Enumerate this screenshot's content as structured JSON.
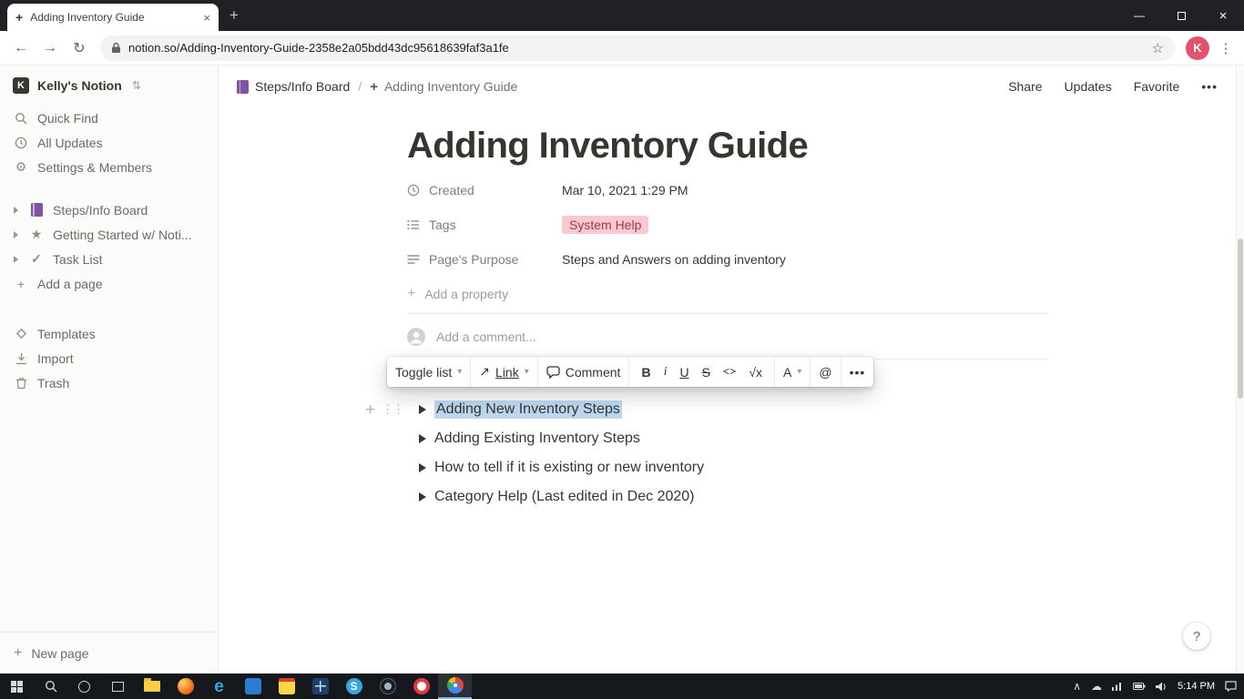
{
  "colors": {
    "selection_blue": "#bcd8f1",
    "tag_pink_bg": "#f9c8d0",
    "tag_pink_text": "#9a3b4d",
    "avatar_red": "#e2546d",
    "book_purple": "#7d54a5",
    "star_yellow": "#f5a623",
    "sidebar_bg": "#fbfbfa"
  },
  "browser": {
    "tab_title": "Adding Inventory Guide",
    "url": "notion.so/Adding-Inventory-Guide-2358e2a05bdd43dc95618639faf3a1fe",
    "profile_initial": "K"
  },
  "icons": {
    "swap": "⇅",
    "back": "←",
    "forward": "→",
    "reload": "↻",
    "bookmark_star": "☆",
    "more_vertical": "⋮",
    "more_horizontal": "•••",
    "chevron_down": "▾",
    "plus": "+",
    "drag_handle": "⋮⋮",
    "star": "★",
    "check": "✓",
    "gear": "⚙",
    "link_arrow": "↗",
    "close": "×",
    "minimize": "—",
    "cloud": "☁",
    "chevron_up": "∧"
  },
  "sidebar": {
    "workspace_name": "Kelly's Notion",
    "workspace_initial": "K",
    "menu": [
      {
        "label": "Quick Find"
      },
      {
        "label": "All Updates"
      },
      {
        "label": "Settings & Members"
      }
    ],
    "pages": [
      {
        "label": "Steps/Info Board"
      },
      {
        "label": "Getting Started w/ Noti..."
      },
      {
        "label": "Task List"
      }
    ],
    "add_page": "Add a page",
    "tools": [
      {
        "label": "Templates"
      },
      {
        "label": "Import"
      },
      {
        "label": "Trash"
      }
    ],
    "new_page": "New page"
  },
  "topbar": {
    "breadcrumb_parent": "Steps/Info Board",
    "breadcrumb_separator": "/",
    "breadcrumb_current": "Adding Inventory Guide",
    "actions": [
      {
        "label": "Share"
      },
      {
        "label": "Updates"
      },
      {
        "label": "Favorite"
      }
    ]
  },
  "page": {
    "title": "Adding Inventory Guide",
    "properties": [
      {
        "name": "Created",
        "value": "Mar 10, 2021 1:29 PM"
      },
      {
        "name": "Tags",
        "value": "System Help"
      },
      {
        "name": "Page's Purpose",
        "value": "Steps and Answers on adding inventory"
      }
    ],
    "add_property": "Add a property",
    "comment_placeholder": "Add a comment...",
    "toggles": [
      {
        "label": "Adding New Inventory Steps",
        "selected": true
      },
      {
        "label": "Adding Existing Inventory Steps",
        "selected": false
      },
      {
        "label": "How to tell if it is existing or new inventory",
        "selected": false
      },
      {
        "label": "Category Help (Last edited in Dec 2020)",
        "selected": false
      }
    ]
  },
  "toolbar": {
    "block_type": "Toggle list",
    "link": "Link",
    "comment": "Comment",
    "bold": "B",
    "italic": "i",
    "underline": "U",
    "strikethrough": "S",
    "code": "<>",
    "equation": "√x",
    "color": "A",
    "mention": "@",
    "more": "•••"
  },
  "help": "?",
  "taskbar": {
    "time": "5:14 PM",
    "app_icons": [
      "file-explorer",
      "firefox",
      "edge",
      "app-blue",
      "notes",
      "spreadsheet",
      "skype",
      "camera",
      "browser-ring",
      "chrome"
    ]
  }
}
